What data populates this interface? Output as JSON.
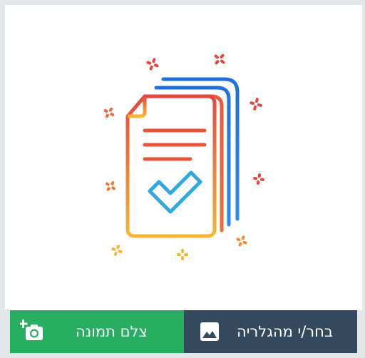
{
  "illustration": {
    "icon": "document-check-icon",
    "sparkle_icon": "sparkle-icon",
    "colors": {
      "gradient_top": "#e8453c",
      "gradient_bottom": "#f7b733",
      "blue_top": "#1f6fe0",
      "blue_bottom": "#2d8cf0",
      "check": "#2fa8e0"
    }
  },
  "actions": {
    "camera": {
      "label": "צלם תמונה",
      "icon": "add-camera-icon",
      "color": "#27ae60"
    },
    "gallery": {
      "label": "בחר/י מהגלריה",
      "icon": "image-icon",
      "color": "#34495e"
    }
  }
}
